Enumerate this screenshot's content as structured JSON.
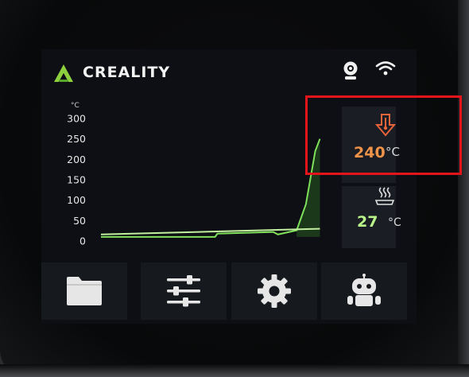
{
  "header": {
    "brand": "CREALITY",
    "logo_icon": "creality-logo-icon",
    "status_icons": [
      "camera-icon",
      "wifi-icon"
    ]
  },
  "temperatures": {
    "nozzle": {
      "icon": "nozzle-temperature-icon",
      "value": "240",
      "unit": "°C",
      "color": "#f2934a"
    },
    "bed": {
      "icon": "heated-bed-icon",
      "value": "27",
      "unit": "°C",
      "color": "#b9f58a"
    }
  },
  "chart_data": {
    "type": "line",
    "unit_label": "°C",
    "y_ticks": [
      "300",
      "250",
      "200",
      "150",
      "100",
      "50",
      "0"
    ],
    "ylim": [
      0,
      300
    ],
    "series": [
      {
        "color": "#7ee05a",
        "x": [
          0,
          0.49,
          0.5,
          0.73,
          0.74,
          0.76,
          0.84,
          0.88,
          0.92,
          0.94
        ],
        "y": [
          10,
          10,
          18,
          22,
          22,
          16,
          26,
          90,
          220,
          250
        ]
      },
      {
        "color": "#c2f0a0",
        "x": [
          0,
          0.94
        ],
        "y": [
          16,
          30
        ]
      }
    ]
  },
  "navigation": {
    "buttons": [
      {
        "name": "files",
        "icon": "folder-icon"
      },
      {
        "name": "controls",
        "icon": "sliders-icon"
      },
      {
        "name": "settings",
        "icon": "gear-icon"
      },
      {
        "name": "assistant",
        "icon": "robot-icon"
      }
    ]
  },
  "annotation": {
    "color": "#e5141b"
  }
}
